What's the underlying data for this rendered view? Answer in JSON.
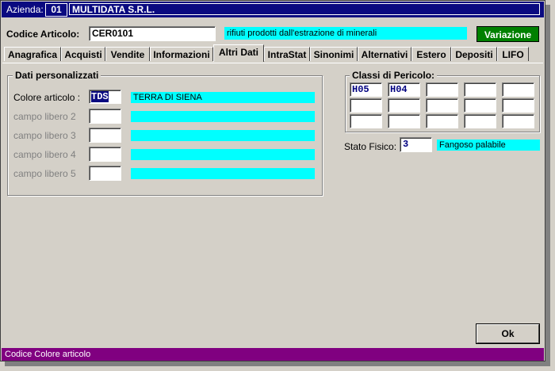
{
  "titlebar": {
    "company_label": "Azienda:",
    "company_code": "01",
    "company_name": "MULTIDATA S.R.L."
  },
  "header": {
    "article_label": "Codice Articolo:",
    "article_code": "CER0101",
    "article_desc": "rifiuti prodotti dall'estrazione di minerali",
    "mode_button": "Variazione"
  },
  "tabs": [
    {
      "label": "Anagrafica"
    },
    {
      "label": "Acquisti"
    },
    {
      "label": "Vendite"
    },
    {
      "label": "Informazioni"
    },
    {
      "label": "Altri Dati"
    },
    {
      "label": "IntraStat"
    },
    {
      "label": "Sinonimi"
    },
    {
      "label": "Alternativi"
    },
    {
      "label": "Estero"
    },
    {
      "label": "Depositi"
    },
    {
      "label": "LIFO"
    }
  ],
  "custom_data": {
    "title": "Dati personalizzati",
    "fields": [
      {
        "label": "Colore articolo :",
        "code": "TDS",
        "desc": "TERRA DI SIENA"
      },
      {
        "label": "campo libero 2",
        "code": "",
        "desc": ""
      },
      {
        "label": "campo libero 3",
        "code": "",
        "desc": ""
      },
      {
        "label": "campo libero 4",
        "code": "",
        "desc": ""
      },
      {
        "label": "campo libero 5",
        "code": "",
        "desc": ""
      }
    ]
  },
  "hazard": {
    "title": "Classi di Pericolo:",
    "cells": [
      "H05",
      "H04",
      "",
      "",
      "",
      "",
      "",
      "",
      "",
      "",
      "",
      "",
      "",
      "",
      ""
    ]
  },
  "physical_state": {
    "label": "Stato Fisico:",
    "code": "3",
    "desc": "Fangoso palabile"
  },
  "ok_button": "Ok",
  "status": "Codice Colore articolo",
  "colors": {
    "titlebar": "#0a0a80",
    "cyan": "#00ffff",
    "green": "#008000",
    "status": "#800080"
  }
}
